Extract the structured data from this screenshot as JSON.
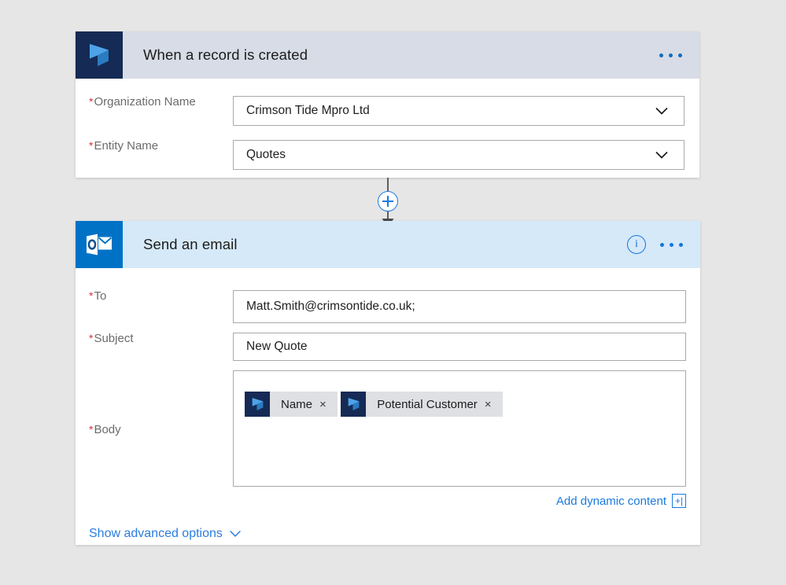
{
  "theme": {
    "canvas_bg": "#e6e6e6",
    "dynamics_tile": "#152a54",
    "outlook_tile": "#0072c6",
    "trigger_header_bg": "#d7dce6",
    "action_header_bg": "#d6e9f8",
    "accent_blue": "#1a7ae0",
    "required_red": "#d13438",
    "token_bg": "#dfe0e4"
  },
  "trigger_card": {
    "icon": "dynamics-365-icon",
    "title": "When a record is created",
    "menu": "ellipsis-menu",
    "fields": [
      {
        "label": "Organization Name",
        "required": true,
        "value": "Crimson Tide Mpro Ltd",
        "control": "dropdown",
        "chevron": "chevron-down-icon"
      },
      {
        "label": "Entity Name",
        "required": true,
        "value": "Quotes",
        "control": "dropdown",
        "chevron": "chevron-down-icon"
      }
    ]
  },
  "connector": {
    "add_step": "+",
    "arrow": "arrow-down-icon"
  },
  "action_card": {
    "icon": "outlook-icon",
    "title": "Send an email",
    "info": "i",
    "menu": "ellipsis-menu",
    "fields": [
      {
        "label": "To",
        "required": true,
        "value": "Matt.Smith@crimsontide.co.uk;",
        "control": "text"
      },
      {
        "label": "Subject",
        "required": true,
        "value": "New Quote",
        "control": "text"
      },
      {
        "label": "Body",
        "required": true,
        "control": "rich-text"
      }
    ],
    "body_tokens": [
      {
        "icon": "dynamics-365-icon",
        "label": "Name",
        "remove": "×"
      },
      {
        "icon": "dynamics-365-icon",
        "label": "Potential Customer",
        "remove": "×"
      }
    ],
    "add_dynamic_content": {
      "label": "Add dynamic content",
      "badge": "+|"
    },
    "show_advanced": {
      "label": "Show advanced options",
      "chevron": "chevron-down-icon"
    }
  }
}
